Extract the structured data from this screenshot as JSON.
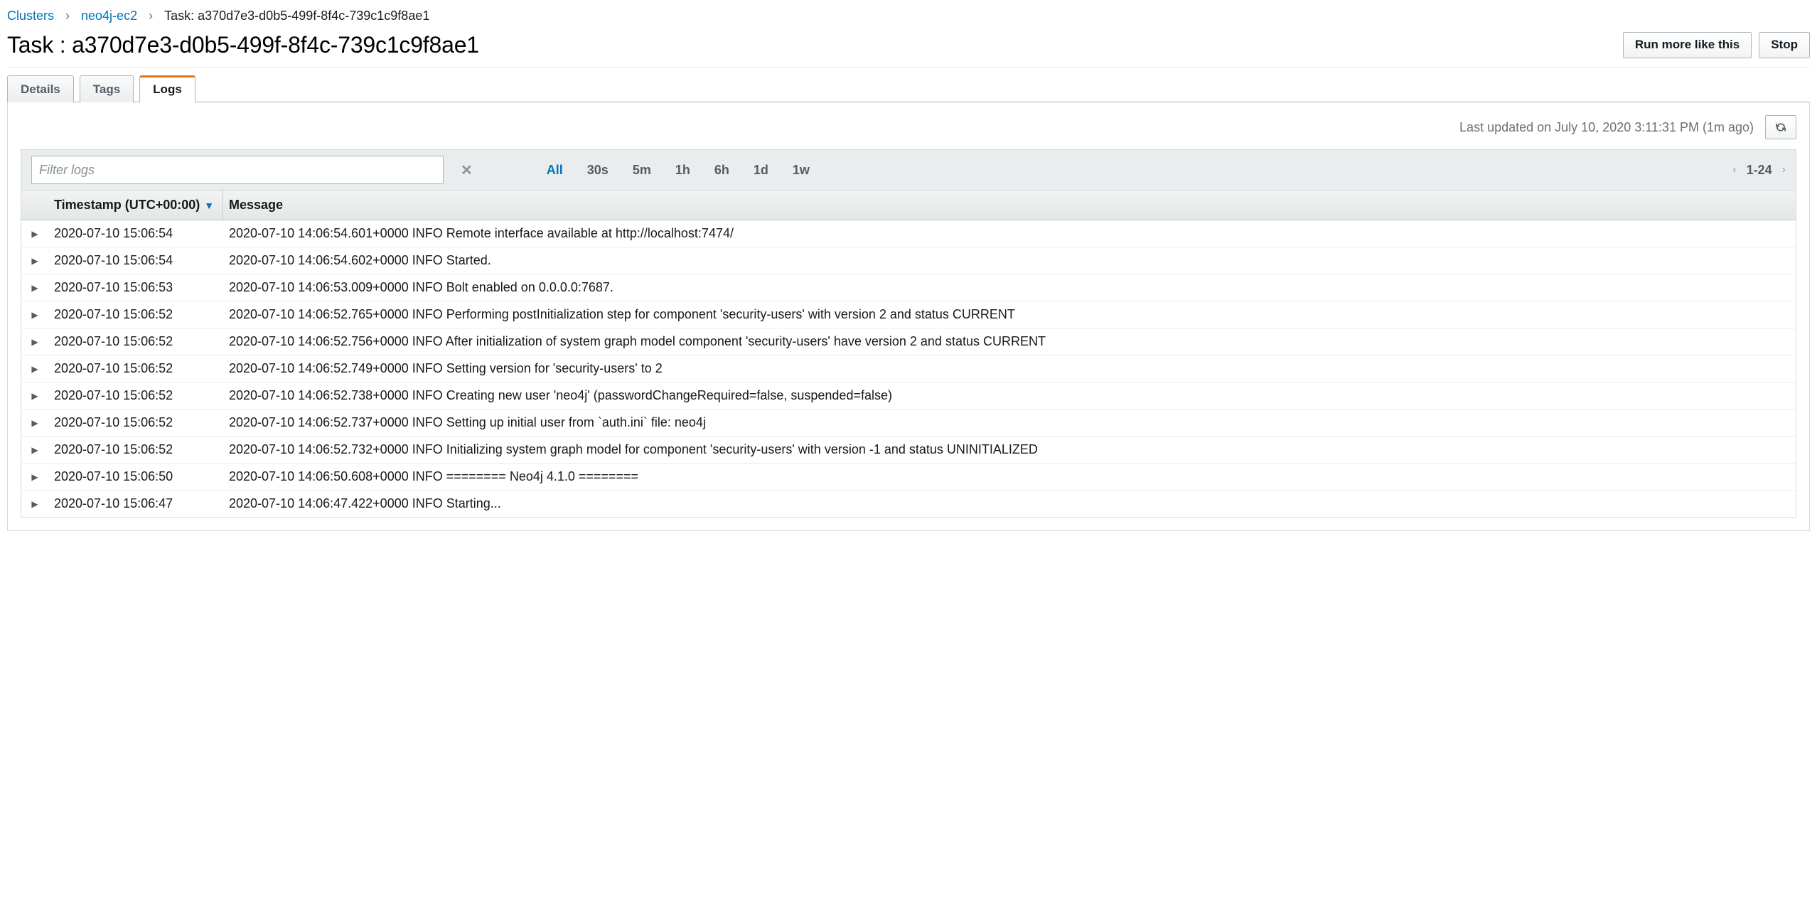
{
  "breadcrumb": {
    "clusters": "Clusters",
    "cluster_name": "neo4j-ec2",
    "current": "Task: a370d7e3-d0b5-499f-8f4c-739c1c9f8ae1"
  },
  "title": "Task : a370d7e3-d0b5-499f-8f4c-739c1c9f8ae1",
  "actions": {
    "run_more": "Run more like this",
    "stop": "Stop"
  },
  "tabs": {
    "details": "Details",
    "tags": "Tags",
    "logs": "Logs"
  },
  "updated": "Last updated on July 10, 2020 3:11:31 PM (1m ago)",
  "filter": {
    "placeholder": "Filter logs"
  },
  "time_ranges": [
    "All",
    "30s",
    "5m",
    "1h",
    "6h",
    "1d",
    "1w"
  ],
  "active_range_index": 0,
  "pager": {
    "range": "1-24"
  },
  "columns": {
    "timestamp": "Timestamp (UTC+00:00)",
    "message": "Message"
  },
  "rows": [
    {
      "ts": "2020-07-10 15:06:54",
      "msg": "2020-07-10 14:06:54.601+0000 INFO Remote interface available at http://localhost:7474/"
    },
    {
      "ts": "2020-07-10 15:06:54",
      "msg": "2020-07-10 14:06:54.602+0000 INFO Started."
    },
    {
      "ts": "2020-07-10 15:06:53",
      "msg": "2020-07-10 14:06:53.009+0000 INFO Bolt enabled on 0.0.0.0:7687."
    },
    {
      "ts": "2020-07-10 15:06:52",
      "msg": "2020-07-10 14:06:52.765+0000 INFO Performing postInitialization step for component 'security-users' with version 2 and status CURRENT"
    },
    {
      "ts": "2020-07-10 15:06:52",
      "msg": "2020-07-10 14:06:52.756+0000 INFO After initialization of system graph model component 'security-users' have version 2 and status CURRENT"
    },
    {
      "ts": "2020-07-10 15:06:52",
      "msg": "2020-07-10 14:06:52.749+0000 INFO Setting version for 'security-users' to 2"
    },
    {
      "ts": "2020-07-10 15:06:52",
      "msg": "2020-07-10 14:06:52.738+0000 INFO Creating new user 'neo4j' (passwordChangeRequired=false, suspended=false)"
    },
    {
      "ts": "2020-07-10 15:06:52",
      "msg": "2020-07-10 14:06:52.737+0000 INFO Setting up initial user from `auth.ini` file: neo4j"
    },
    {
      "ts": "2020-07-10 15:06:52",
      "msg": "2020-07-10 14:06:52.732+0000 INFO Initializing system graph model for component 'security-users' with version -1 and status UNINITIALIZED"
    },
    {
      "ts": "2020-07-10 15:06:50",
      "msg": "2020-07-10 14:06:50.608+0000 INFO ======== Neo4j 4.1.0 ========"
    },
    {
      "ts": "2020-07-10 15:06:47",
      "msg": "2020-07-10 14:06:47.422+0000 INFO Starting..."
    }
  ]
}
